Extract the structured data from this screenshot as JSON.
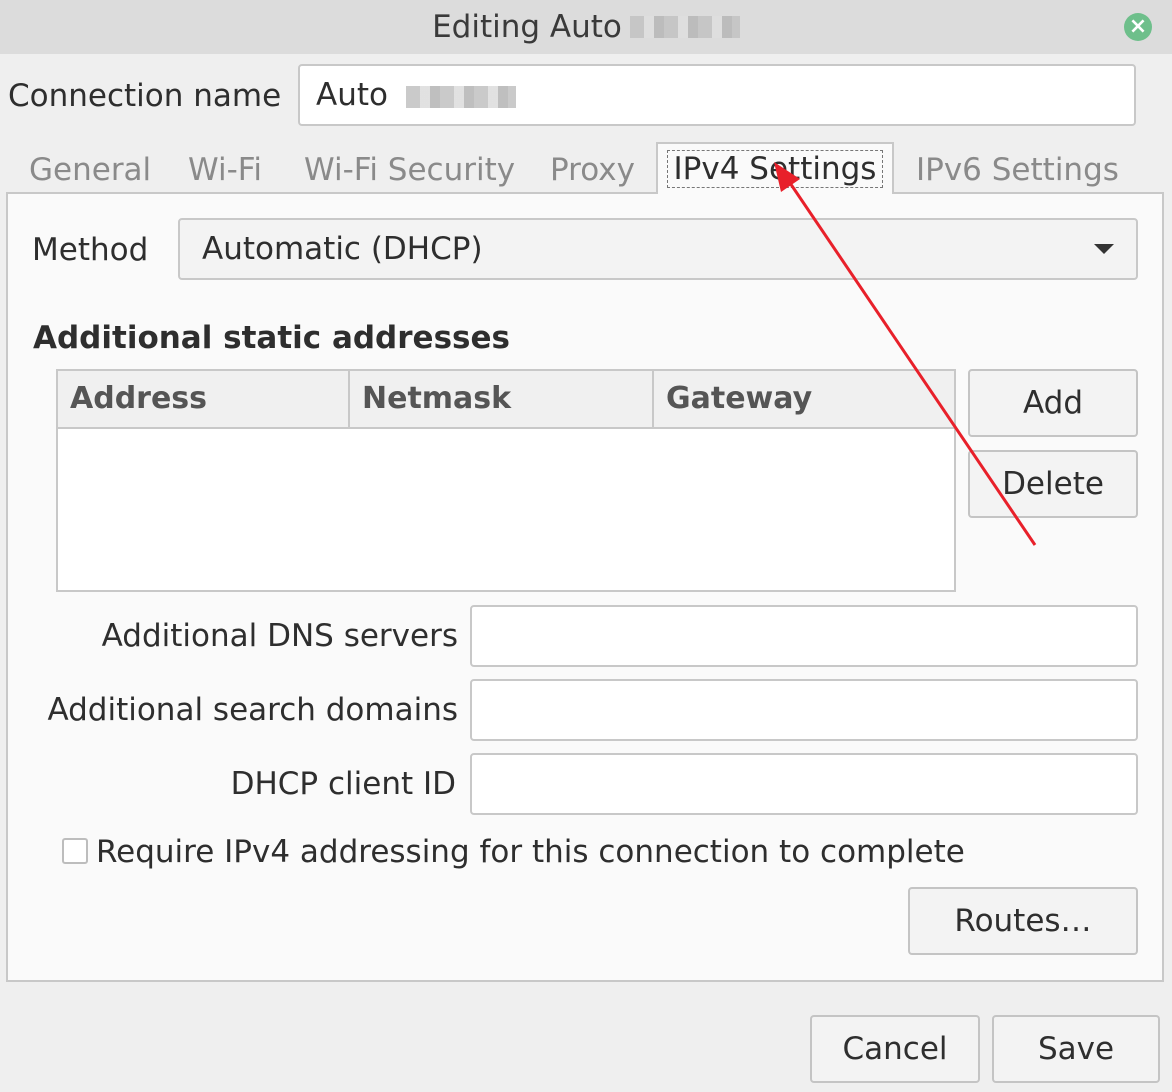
{
  "window": {
    "title": "Editing Auto"
  },
  "connection": {
    "label": "Connection name",
    "value": "Auto"
  },
  "tabs": [
    {
      "label": "General"
    },
    {
      "label": "Wi-Fi"
    },
    {
      "label": "Wi-Fi Security"
    },
    {
      "label": "Proxy"
    },
    {
      "label": "IPv4 Settings"
    },
    {
      "label": "IPv6 Settings"
    }
  ],
  "method": {
    "label": "Method",
    "value": "Automatic (DHCP)"
  },
  "static_addresses": {
    "title": "Additional static addresses",
    "columns": [
      "Address",
      "Netmask",
      "Gateway"
    ],
    "add_label": "Add",
    "delete_label": "Delete"
  },
  "fields": {
    "dns_label": "Additional DNS servers",
    "search_label": "Additional search domains",
    "dhcp_label": "DHCP client ID"
  },
  "require": {
    "label": "Require IPv4 addressing for this connection to complete"
  },
  "routes_label": "Routes…",
  "footer": {
    "cancel_label": "Cancel",
    "save_label": "Save"
  },
  "annotation": {
    "arrow_color": "#e8202a"
  }
}
